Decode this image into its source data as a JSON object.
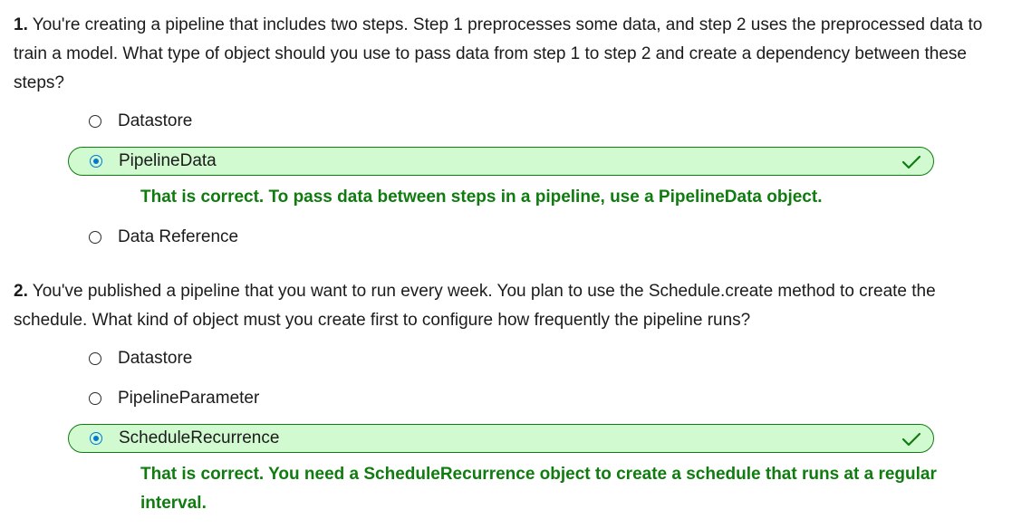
{
  "questions": [
    {
      "number": "1.",
      "text": "You're creating a pipeline that includes two steps. Step 1 preprocesses some data, and step 2 uses the preprocessed data to train a model. What type of object should you use to pass data from step 1 to step 2 and create a dependency between these steps?",
      "options": [
        {
          "label": "Datastore"
        },
        {
          "label": "PipelineData"
        },
        {
          "label": "Data Reference"
        }
      ],
      "selected_index": 1,
      "feedback": "That is correct. To pass data between steps in a pipeline, use a PipelineData object."
    },
    {
      "number": "2.",
      "text": "You've published a pipeline that you want to run every week. You plan to use the Schedule.create method to create the schedule. What kind of object must you create first to configure how frequently the pipeline runs?",
      "options": [
        {
          "label": "Datastore"
        },
        {
          "label": "PipelineParameter"
        },
        {
          "label": "ScheduleRecurrence"
        }
      ],
      "selected_index": 2,
      "feedback": "That is correct. You need a ScheduleRecurrence object to create a schedule that runs at a regular interval."
    }
  ],
  "colors": {
    "correct_text": "#107c10",
    "correct_bg": "#d1fad1",
    "radio_selected": "#0078d4"
  }
}
